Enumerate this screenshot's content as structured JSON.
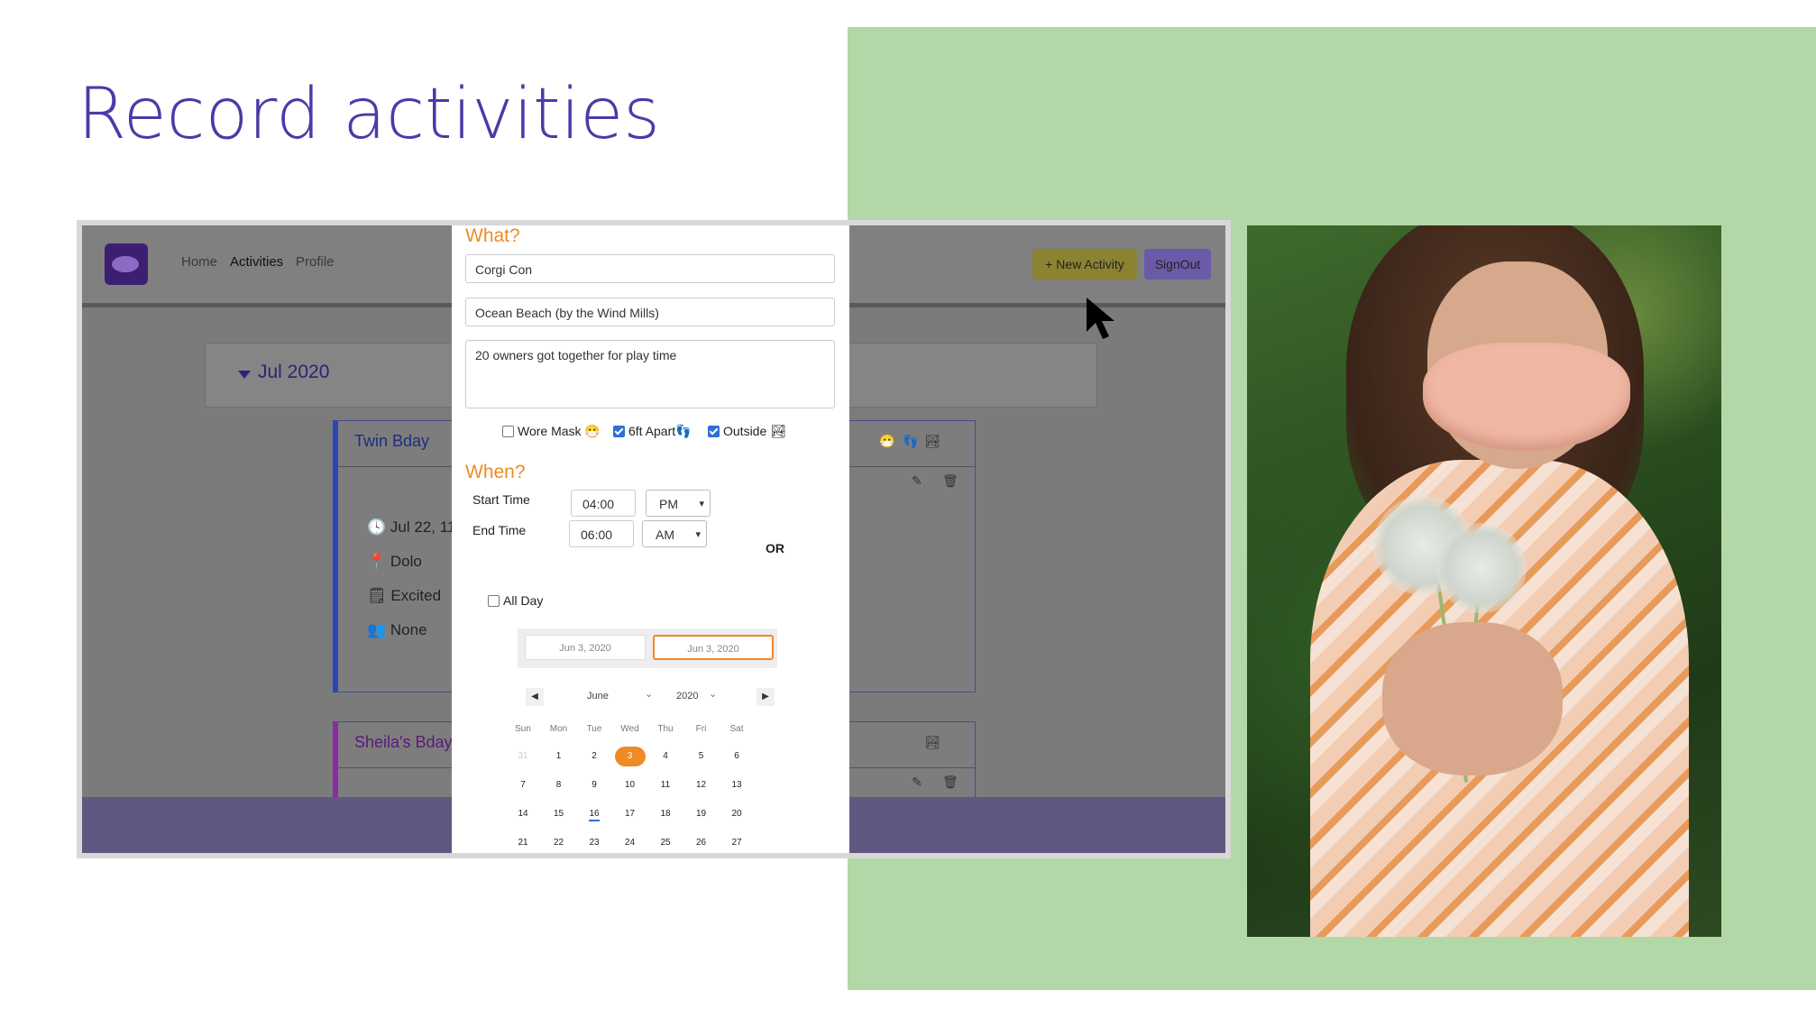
{
  "slide": {
    "title": "Record activities"
  },
  "app": {
    "nav": [
      "Home",
      "Activities",
      "Profile"
    ],
    "new_activity_label": "+ New Activity",
    "signout_label": "SignOut",
    "month_label": "Jul 2020",
    "cards": [
      {
        "title": "Twin Bday",
        "datetime": "Jul 22, 11:",
        "location": "Dolo",
        "mood": "Excited",
        "people": "None"
      },
      {
        "title": "Sheila's Bday"
      }
    ]
  },
  "modal": {
    "what_heading": "What?",
    "activity_name": "Corgi Con",
    "location": "Ocean Beach (by the Wind Mills)",
    "notes": "20 owners got together for play time",
    "checks": [
      {
        "label": "Wore Mask 😷",
        "checked": false
      },
      {
        "label": "6ft Apart👣",
        "checked": true
      },
      {
        "label": "Outside 🏞",
        "checked": true
      }
    ],
    "when_heading": "When?",
    "start_time_label": "Start Time",
    "start_time": "04:00",
    "start_ampm": "PM",
    "end_time_label": "End Time",
    "end_time": "06:00",
    "end_ampm": "AM",
    "or_label": "OR",
    "all_day_label": "All Day",
    "range_start": "Jun 3, 2020",
    "range_end": "Jun 3, 2020",
    "calendar": {
      "month": "June",
      "year": "2020",
      "weekdays": [
        "Sun",
        "Mon",
        "Tue",
        "Wed",
        "Thu",
        "Fri",
        "Sat"
      ],
      "weeks": [
        [
          "31",
          "1",
          "2",
          "3",
          "4",
          "5",
          "6"
        ],
        [
          "7",
          "8",
          "9",
          "10",
          "11",
          "12",
          "13"
        ],
        [
          "14",
          "15",
          "16",
          "17",
          "18",
          "19",
          "20"
        ],
        [
          "21",
          "22",
          "23",
          "24",
          "25",
          "26",
          "27"
        ]
      ],
      "selected_day": "3",
      "today_day": "16"
    }
  }
}
